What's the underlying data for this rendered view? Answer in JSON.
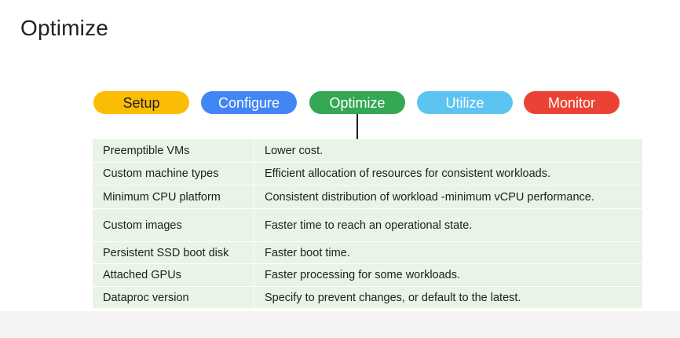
{
  "title": "Optimize",
  "steps": [
    {
      "label": "Setup",
      "bg": "#fbbc04",
      "fg": "#202124"
    },
    {
      "label": "Configure",
      "bg": "#4285f4",
      "fg": "#ffffff"
    },
    {
      "label": "Optimize",
      "bg": "#34a853",
      "fg": "#ffffff"
    },
    {
      "label": "Utilize",
      "bg": "#5bc4f1",
      "fg": "#ffffff"
    },
    {
      "label": "Monitor",
      "bg": "#ea4335",
      "fg": "#ffffff"
    }
  ],
  "active_step": "Optimize",
  "table_bg": "#e9f3e6",
  "rows": [
    {
      "feature": "Preemptible VMs",
      "benefit": "Lower cost."
    },
    {
      "feature": "Custom machine types",
      "benefit": "Efficient allocation of resources for consistent workloads."
    },
    {
      "feature": "Minimum CPU platform",
      "benefit": "Consistent distribution of workload -minimum vCPU performance."
    },
    {
      "feature": "Custom images",
      "benefit": "Faster time to reach an operational state."
    },
    {
      "feature": "Persistent SSD boot disk",
      "benefit": "Faster boot time."
    },
    {
      "feature": "Attached GPUs",
      "benefit": "Faster processing for some workloads."
    },
    {
      "feature": "Dataproc version",
      "benefit": "Specify to prevent changes, or default to the latest."
    }
  ]
}
